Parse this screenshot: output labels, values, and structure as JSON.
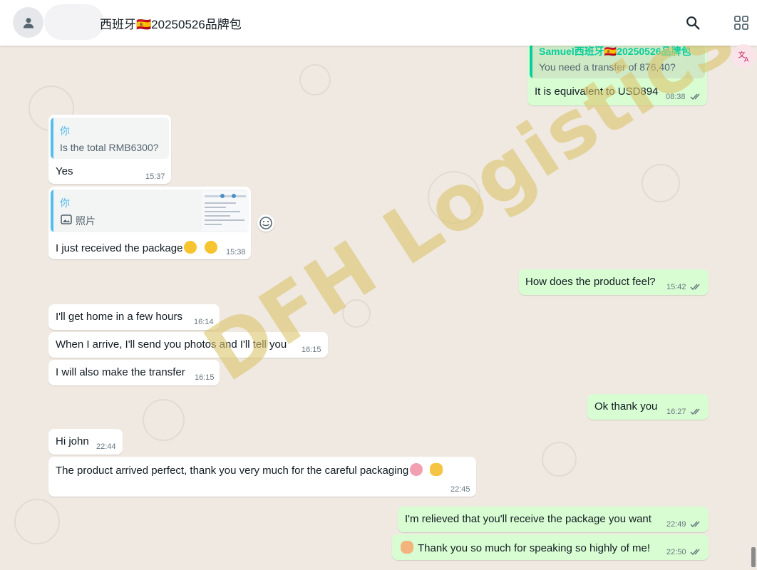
{
  "header": {
    "title": "西班牙🇪🇸20250526品牌包",
    "avatar_icon": "person-icon",
    "search_icon": "search-icon",
    "more_icon": "apps-icon",
    "translate_icon": "translate-icon"
  },
  "watermark": "DFH Logistics",
  "messages": [
    {
      "direction": "out",
      "quote_author": "Samuel西班牙🇪🇸20250526品牌包",
      "quote_text": "You need a transfer of 876,40?",
      "text": "It is equivalent to USD894",
      "time": "08:38",
      "read": true
    },
    {
      "direction": "in",
      "quote_author": "你",
      "quote_text": "Is the total RMB6300?",
      "text": "Yes",
      "time": "15:37"
    },
    {
      "direction": "in",
      "quote_author": "你",
      "quote_text": "照片",
      "quote_icon": "image-icon",
      "text": "I just received the package",
      "time": "15:38"
    },
    {
      "direction": "out",
      "text": "How does the product feel?",
      "time": "15:42",
      "read": true
    },
    {
      "direction": "in",
      "text": "I'll get home in a few hours",
      "time": "16:14"
    },
    {
      "direction": "in",
      "text": "When I arrive, I'll send you photos and I'll tell you",
      "time": "16:15"
    },
    {
      "direction": "in",
      "text": "I will also make the transfer",
      "time": "16:15"
    },
    {
      "direction": "out",
      "text": "Ok thank you",
      "time": "16:27",
      "read": true
    },
    {
      "direction": "in",
      "text": "Hi john",
      "time": "22:44"
    },
    {
      "direction": "in",
      "text": "The product arrived perfect, thank you very much for the careful packaging",
      "time": "22:45"
    },
    {
      "direction": "out",
      "text": "I'm relieved that you'll receive the package you want",
      "time": "22:49",
      "read": true
    },
    {
      "direction": "out",
      "text": "Thank you so much for speaking so highly of me!",
      "time": "22:50",
      "read": true
    }
  ],
  "colors": {
    "outgoing_bubble": "#d9fdd3",
    "incoming_bubble": "#ffffff",
    "chat_background": "#efe9e1",
    "quote_author_green": "#53bdeb",
    "read_ticks": "#667781"
  }
}
